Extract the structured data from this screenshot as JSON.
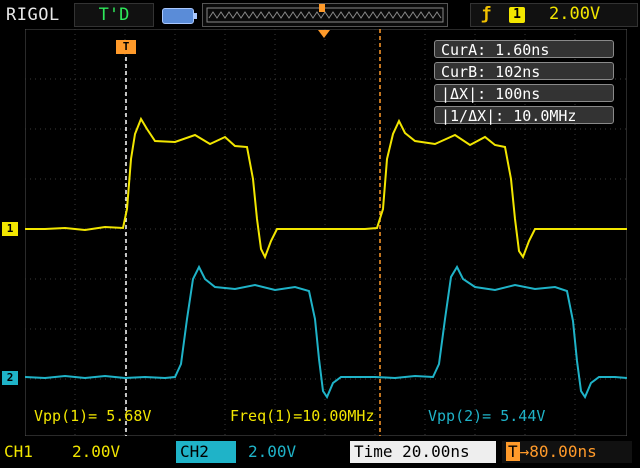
{
  "header": {
    "brand": "RIGOL",
    "run_status": "T'D",
    "trigger_slope_icon": "rising-edge-icon",
    "trigger_source": "1",
    "trigger_level": "2.00V"
  },
  "cursors": {
    "cur_a": "CurA: 1.60ns",
    "cur_b": "CurB: 102ns",
    "delta_x": "|ΔX|: 100ns",
    "inv_delta_x": "|1/ΔX|: 10.0MHz"
  },
  "markers": {
    "trigger_position": "T",
    "ch1": "1",
    "ch2": "2"
  },
  "measurements": {
    "vpp1": "Vpp(1)= 5.68V",
    "freq1": "Freq(1)=10.00MHz",
    "vpp2": "Vpp(2)= 5.44V"
  },
  "footer": {
    "ch1_label": "CH1",
    "ch1_scale": "2.00V",
    "ch2_label": "CH2",
    "ch2_scale": "2.00V",
    "timebase": "Time 20.00ns",
    "delay": "80.00ns"
  },
  "colors": {
    "ch1": "#f2e600",
    "ch2": "#1fb3c8",
    "cursor": "#ff9a2a",
    "grid": "#3a3a3a"
  }
}
